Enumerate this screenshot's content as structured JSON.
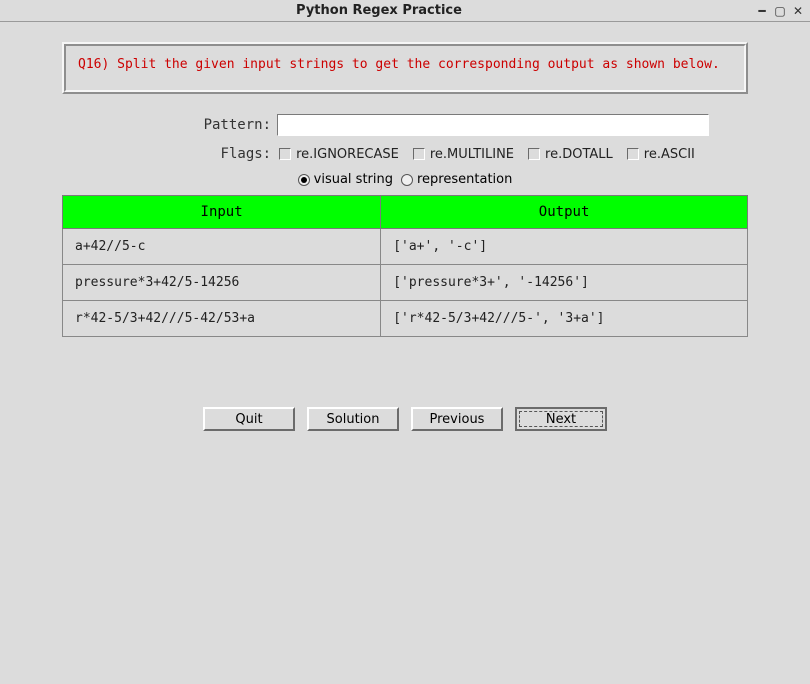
{
  "window": {
    "title": "Python Regex Practice"
  },
  "question_text": "Q16) Split the given input strings to get the corresponding output as shown below.",
  "pattern": {
    "label": "Pattern:",
    "value": ""
  },
  "flags": {
    "label": "Flags:",
    "ignorecase": "re.IGNORECASE",
    "multiline": "re.MULTILINE",
    "dotall": "re.DOTALL",
    "ascii": "re.ASCII"
  },
  "view": {
    "visual": "visual string",
    "repr": "representation",
    "selected": "visual"
  },
  "table": {
    "headers": {
      "input": "Input",
      "output": "Output"
    },
    "rows": [
      {
        "input": "a+42//5-c",
        "output": "['a+', '-c']"
      },
      {
        "input": "pressure*3+42/5-14256",
        "output": "['pressure*3+', '-14256']"
      },
      {
        "input": "r*42-5/3+42///5-42/53+a",
        "output": "['r*42-5/3+42///5-', '3+a']"
      }
    ]
  },
  "buttons": {
    "quit": "Quit",
    "solution": "Solution",
    "previous": "Previous",
    "next": "Next"
  }
}
